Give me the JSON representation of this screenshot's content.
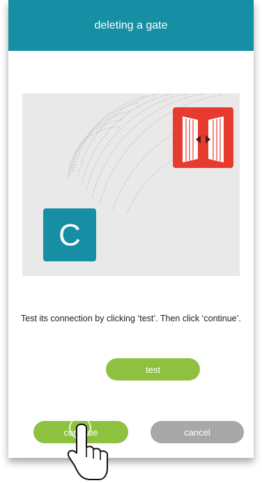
{
  "header": {
    "title": "deleting a gate"
  },
  "illustration": {
    "app_icon_letter": "C",
    "app_icon": "connector-app-icon",
    "gate_icon": "sliding-gate-icon",
    "signal_icon": "signal-waves-icon"
  },
  "actions": {
    "test_label": "test",
    "continue_label": "continue",
    "cancel_label": "cancel"
  },
  "instruction": "Test its connection by clicking ‘test’. Then click ‘continue’.",
  "colors": {
    "header": "#168ea4",
    "primary_button": "#8ec13f",
    "secondary_button": "#a7a8aa",
    "gate_red": "#e63b2e",
    "app_icon_teal": "#168ea4"
  },
  "pointer": "hand-pointer-icon"
}
